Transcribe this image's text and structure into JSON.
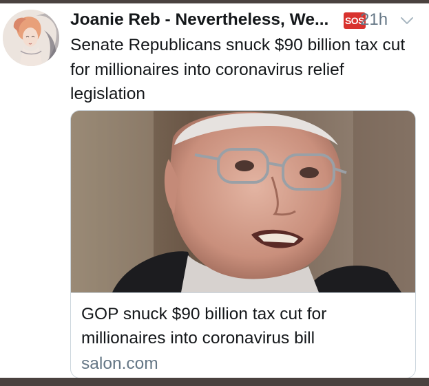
{
  "tweet": {
    "author_name": "Joanie Reb - Nevertheless, We...",
    "badge": "SOS",
    "timestamp": "21h",
    "text": "Senate Republicans snuck $90 billion tax cut for millionaires into coronavirus relief legislation",
    "avatar_icon": "woman-portrait-avatar",
    "menu_icon": "chevron-down-icon"
  },
  "card": {
    "title": "GOP snuck $90 billion tax cut for millionaires into coronavirus bill",
    "domain": "salon.com",
    "image_subject": "older-man-with-glasses-photo"
  },
  "colors": {
    "text": "#14171a",
    "secondary": "#657786",
    "border": "#ccd6dd",
    "badge": "#d8322e",
    "frame": "#4a423f"
  }
}
